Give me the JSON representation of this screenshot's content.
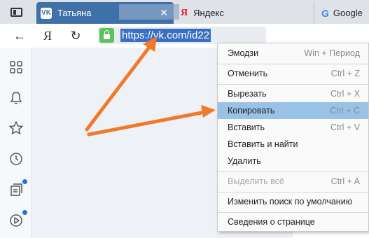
{
  "tabs": {
    "active": {
      "favicon": "VK",
      "title": "Татьяна",
      "close_icon": "✕"
    },
    "yandex": {
      "favicon": "Я",
      "title": "Яндекс"
    },
    "google": {
      "favicon": "G",
      "title": "Google"
    }
  },
  "toolbar": {
    "back_icon": "←",
    "yandex_icon": "Я",
    "reload_icon": "↻",
    "url": "https://vk.com/id22"
  },
  "context_menu": {
    "items": [
      {
        "label": "Эмодзи",
        "shortcut": "Win + Период"
      },
      {
        "label": "Отменить",
        "shortcut": "Ctrl + Z"
      },
      {
        "label": "Вырезать",
        "shortcut": "Ctrl + X"
      },
      {
        "label": "Копировать",
        "shortcut": "Ctrl + C"
      },
      {
        "label": "Вставить",
        "shortcut": "Ctrl + V"
      },
      {
        "label": "Вставить и найти",
        "shortcut": ""
      },
      {
        "label": "Удалить",
        "shortcut": ""
      },
      {
        "label": "Выделить всё",
        "shortcut": "Ctrl + A"
      },
      {
        "label": "Изменить поиск по умолчанию",
        "shortcut": ""
      },
      {
        "label": "Сведения о странице",
        "shortcut": ""
      }
    ]
  },
  "colors": {
    "highlight": "#99c3e6",
    "arrow": "#f07a2a",
    "active_tab": "#3f70a8",
    "url_selection": "#3b6fc2"
  }
}
